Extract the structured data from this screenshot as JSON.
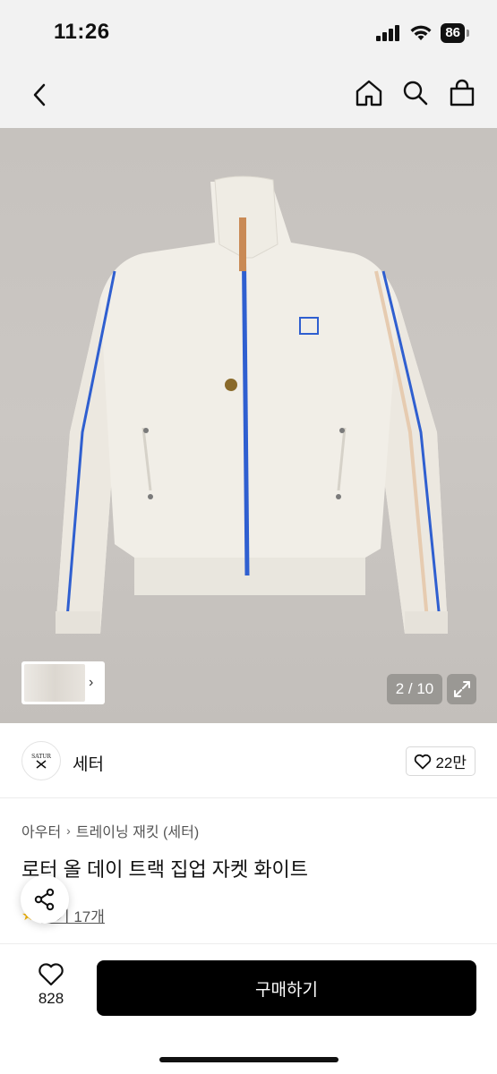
{
  "status": {
    "time": "11:26",
    "battery": "86"
  },
  "nav": {
    "icons": [
      "back-icon",
      "home-icon",
      "search-icon",
      "shopping-bag-icon"
    ]
  },
  "gallery": {
    "counter": "2 / 10"
  },
  "brand": {
    "name": "세터",
    "logo_text": "SATUR",
    "likes": "22만"
  },
  "breadcrumb": {
    "items": [
      "아우터",
      "트레이닝 재킷 (세터)"
    ]
  },
  "product": {
    "title": "로터 올 데이 트랙 집업 자켓 화이트",
    "rating_stars": "★",
    "review_label": "후기 17개"
  },
  "actions": {
    "wish_count": "828",
    "buy_label": "구매하기"
  },
  "colors": {
    "accent_zipper": "#2f5fd0",
    "button": "#000000",
    "star": "#f5b400"
  }
}
